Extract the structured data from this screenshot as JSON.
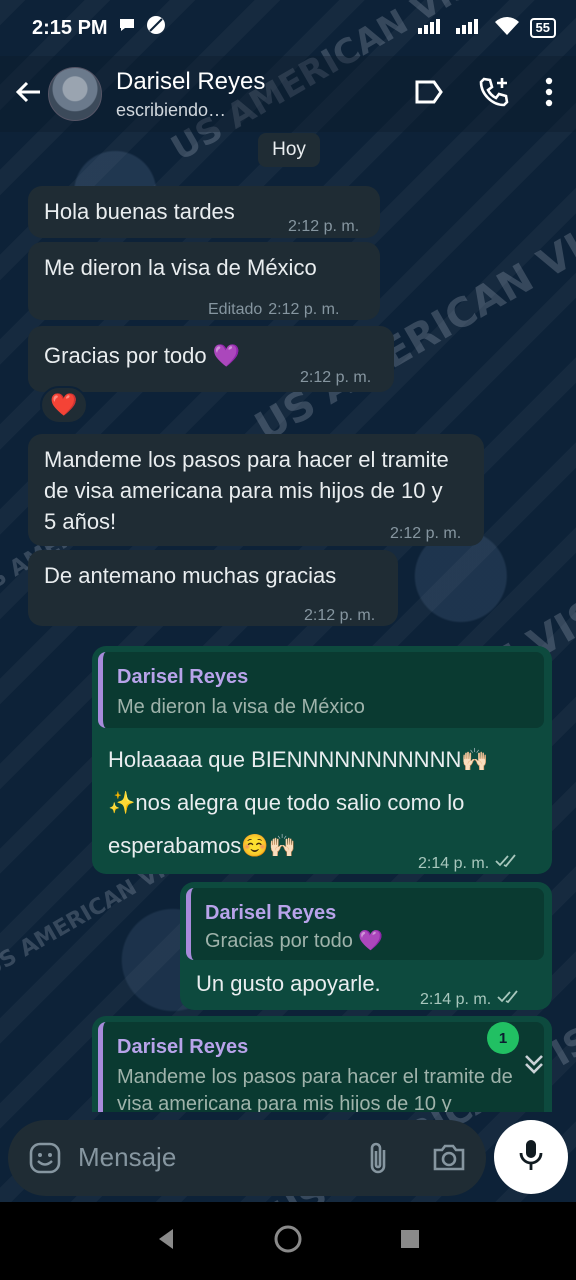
{
  "status_bar": {
    "time": "2:15 PM",
    "battery": "55"
  },
  "header": {
    "contact_name": "Darisel Reyes",
    "contact_status": "escribiendo…"
  },
  "date_chip": "Hoy",
  "watermark": "US AMERICAN VISA",
  "messages": [
    {
      "direction": "in",
      "text": "Hola buenas tardes",
      "time": "2:12 p. m."
    },
    {
      "direction": "in",
      "text": "Me dieron la visa de México",
      "edited_label": "Editado",
      "time": "2:12 p. m."
    },
    {
      "direction": "in",
      "text": "Gracias por todo 💜",
      "time": "2:12 p. m.",
      "reaction": "❤️"
    },
    {
      "direction": "in",
      "text": "Mandeme los pasos para hacer el tramite de visa americana para mis hijos de 10 y 5 años!",
      "time": "2:12 p. m."
    },
    {
      "direction": "in",
      "text": "De antemano muchas gracias",
      "time": "2:12 p. m."
    },
    {
      "direction": "out",
      "quote_name": "Darisel Reyes",
      "quote_text": "Me dieron la visa de México",
      "text": "Holaaaaa que BIENNNNNNNNNNN🙌🏻✨nos alegra que todo salio como lo esperabamos☺️🙌🏻",
      "time": "2:14 p. m."
    },
    {
      "direction": "out",
      "quote_name": "Darisel Reyes",
      "quote_text": "Gracias por todo 💜",
      "text": "Un gusto apoyarle.",
      "time": "2:14 p. m."
    },
    {
      "direction": "out",
      "quote_name": "Darisel Reyes",
      "quote_text": "Mandeme los pasos para hacer el tramite de visa americana para mis hijos de 10 y"
    }
  ],
  "unread_count": "1",
  "input": {
    "placeholder": "Mensaje"
  },
  "colors": {
    "incoming_bubble": "#1f2c34",
    "outgoing_bubble": "#0d4a3e",
    "quote_accent": "#a78bdb",
    "unread_badge": "#21c063"
  },
  "icons": [
    "back-arrow-icon",
    "label-icon",
    "add-call-icon",
    "more-vert-icon",
    "emoji-icon",
    "attach-icon",
    "camera-icon",
    "mic-icon",
    "double-check-icon",
    "chevrons-down-icon"
  ]
}
